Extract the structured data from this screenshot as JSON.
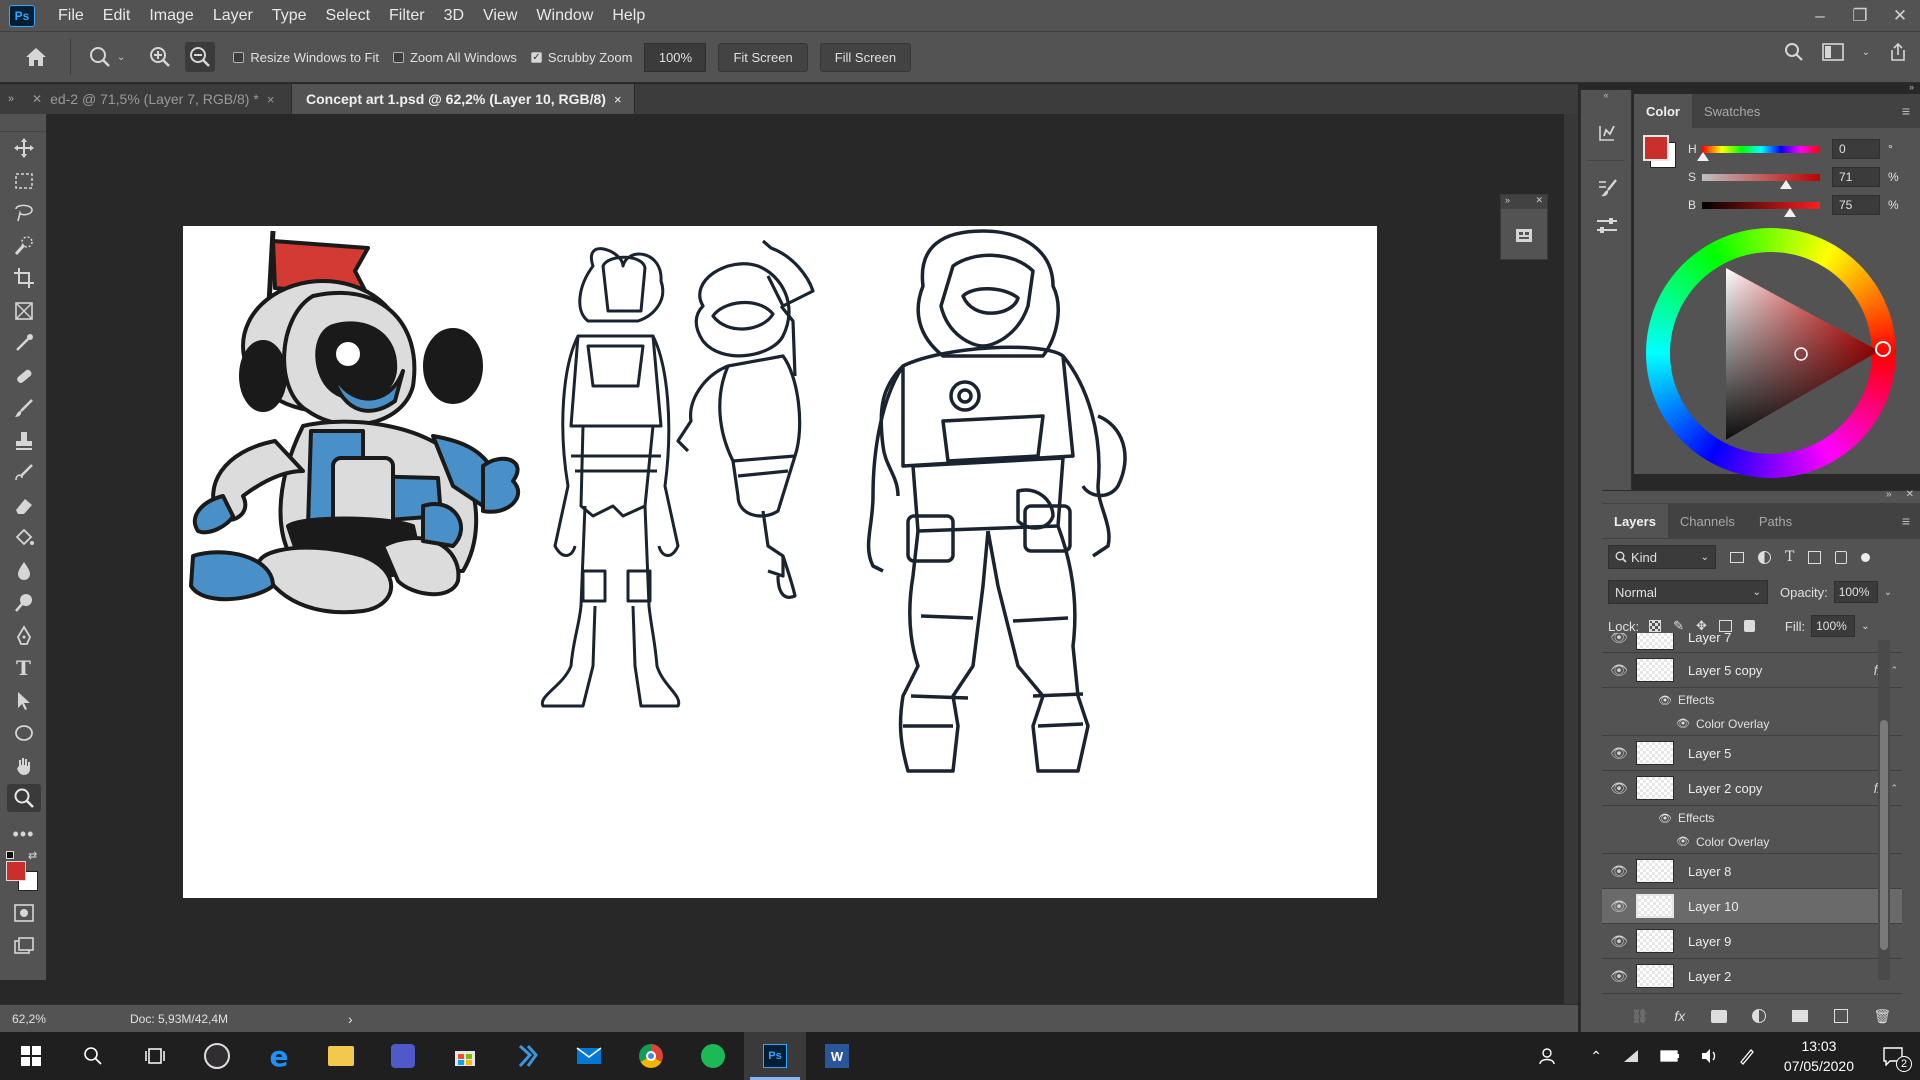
{
  "app": {
    "name": "Ps",
    "accent_color": "#31a8ff",
    "foreground_color": "#c9302c"
  },
  "menu": [
    "File",
    "Edit",
    "Image",
    "Layer",
    "Type",
    "Select",
    "Filter",
    "3D",
    "View",
    "Window",
    "Help"
  ],
  "window_controls": {
    "minimize": "–",
    "restore": "❐",
    "close": "✕"
  },
  "options_bar": {
    "resize_windows_label": "Resize Windows to Fit",
    "resize_windows_checked": false,
    "zoom_all_label": "Zoom All Windows",
    "zoom_all_checked": false,
    "scrubby_zoom_label": "Scrubby Zoom",
    "scrubby_zoom_checked": true,
    "zoom_value": "100%",
    "fit_screen": "Fit Screen",
    "fill_screen": "Fill Screen"
  },
  "tabs": [
    {
      "label": "ed-2 @ 71,5% (Layer 7, RGB/8) *",
      "close": "×",
      "active": false
    },
    {
      "label": "Concept art 1.psd @ 62,2% (Layer 10, RGB/8)",
      "close": "×",
      "active": true
    }
  ],
  "tools": [
    "move-tool",
    "marquee-tool",
    "lasso-tool",
    "quick-select-tool",
    "crop-tool",
    "frame-tool",
    "eyedropper-tool",
    "healing-brush-tool",
    "brush-tool",
    "clone-stamp-tool",
    "history-brush-tool",
    "eraser-tool",
    "paint-bucket-tool",
    "blur-tool",
    "dodge-tool",
    "pen-tool",
    "type-tool",
    "path-select-tool",
    "ellipse-tool",
    "hand-tool",
    "zoom-tool",
    "more-tools"
  ],
  "color_panel": {
    "tabs": [
      "Color",
      "Swatches"
    ],
    "h": {
      "label": "H",
      "value": "0",
      "unit": "°"
    },
    "s": {
      "label": "S",
      "value": "71",
      "unit": "%"
    },
    "b": {
      "label": "B",
      "value": "75",
      "unit": "%"
    }
  },
  "layers_panel": {
    "tabs": [
      "Layers",
      "Channels",
      "Paths"
    ],
    "kind_label": "Kind",
    "blend_mode": "Normal",
    "opacity_label": "Opacity:",
    "opacity_value": "100%",
    "lock_label": "Lock:",
    "fill_label": "Fill:",
    "fill_value": "100%",
    "layers": [
      {
        "name": "Layer 7",
        "fx": false,
        "selected": false
      },
      {
        "name": "Layer 5 copy",
        "fx": true,
        "effects_label": "Effects",
        "effect": "Color Overlay",
        "selected": false
      },
      {
        "name": "Layer 5",
        "fx": false,
        "selected": false
      },
      {
        "name": "Layer 2 copy",
        "fx": true,
        "effects_label": "Effects",
        "effect": "Color Overlay",
        "selected": false
      },
      {
        "name": "Layer 8",
        "fx": false,
        "selected": false
      },
      {
        "name": "Layer 10",
        "fx": false,
        "selected": true
      },
      {
        "name": "Layer 9",
        "fx": false,
        "selected": false
      },
      {
        "name": "Layer 2",
        "fx": false,
        "selected": false
      }
    ],
    "fx_symbol": "fx"
  },
  "status": {
    "zoom": "62,2%",
    "doc": "Doc: 5,93M/42,4M",
    "arrow": "›"
  },
  "taskbar": {
    "apps": [
      "windows-start",
      "search",
      "task-view",
      "obs",
      "edge",
      "file-explorer",
      "teams",
      "store",
      "visual-studio",
      "mail",
      "chrome",
      "spotify",
      "photoshop",
      "word"
    ],
    "active_app": "photoshop",
    "time": "13:03",
    "date": "07/05/2020",
    "notifications": "2"
  }
}
